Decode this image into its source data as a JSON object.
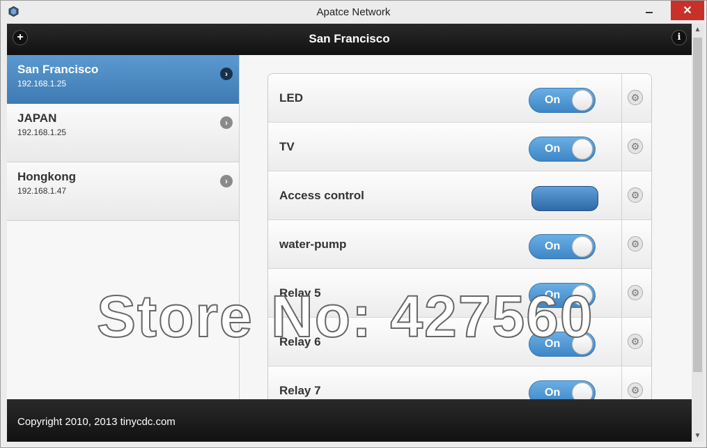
{
  "window": {
    "title": "Apatce Network"
  },
  "header": {
    "title": "San Francisco",
    "add_icon": "plus-icon",
    "info_icon": "info-icon"
  },
  "sidebar": {
    "items": [
      {
        "name": "San Francisco",
        "ip": "192.168.1.25",
        "active": true
      },
      {
        "name": "JAPAN",
        "ip": "192.168.1.25",
        "active": false
      },
      {
        "name": "Hongkong",
        "ip": "192.168.1.47",
        "active": false
      }
    ]
  },
  "devices": [
    {
      "label": "LED",
      "control": "toggle",
      "state": "On"
    },
    {
      "label": "TV",
      "control": "toggle",
      "state": "On"
    },
    {
      "label": "Access control",
      "control": "button",
      "state": ""
    },
    {
      "label": "water-pump",
      "control": "toggle",
      "state": "On"
    },
    {
      "label": "Relay 5",
      "control": "toggle",
      "state": "On"
    },
    {
      "label": "Relay 6",
      "control": "toggle",
      "state": "On"
    },
    {
      "label": "Relay 7",
      "control": "toggle",
      "state": "On"
    }
  ],
  "footer": {
    "text": "Copyright 2010, 2013 tinycdc.com"
  },
  "watermark": "Store No: 427560",
  "colors": {
    "accent": "#3d86c6",
    "active_item": "#4a86bf",
    "bar": "#1a1a1a"
  }
}
